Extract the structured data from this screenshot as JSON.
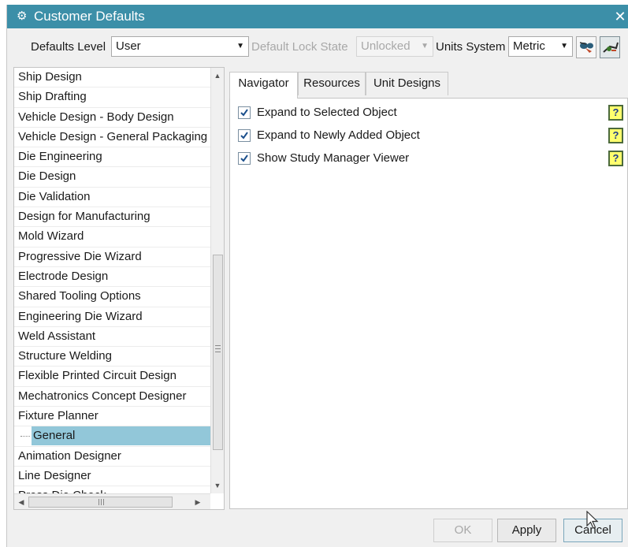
{
  "window": {
    "title": "Customer Defaults",
    "close_glyph": "✕",
    "title_icon": "gear-icon"
  },
  "toolbar": {
    "defaults_level_label": "Defaults Level",
    "defaults_level_value": "User",
    "lock_state_label": "Default Lock State",
    "lock_state_value": "Unlocked",
    "units_label": "Units System",
    "units_value": "Metric",
    "tool1_icon": "find-default-icon",
    "tool2_icon": "show-changed-icon"
  },
  "tree": {
    "items": [
      {
        "label": "Ship Design"
      },
      {
        "label": "Ship Drafting"
      },
      {
        "label": "Vehicle Design - Body Design"
      },
      {
        "label": "Vehicle Design - General Packaging"
      },
      {
        "label": "Die Engineering"
      },
      {
        "label": "Die Design"
      },
      {
        "label": "Die Validation"
      },
      {
        "label": "Design for Manufacturing"
      },
      {
        "label": "Mold Wizard"
      },
      {
        "label": "Progressive Die Wizard"
      },
      {
        "label": "Electrode Design"
      },
      {
        "label": "Shared Tooling Options"
      },
      {
        "label": "Engineering Die Wizard"
      },
      {
        "label": "Weld Assistant"
      },
      {
        "label": "Structure Welding"
      },
      {
        "label": "Flexible Printed Circuit Design"
      },
      {
        "label": "Mechatronics Concept Designer"
      },
      {
        "label": "Fixture Planner"
      },
      {
        "label": "General",
        "child": true,
        "selected": true
      },
      {
        "label": "Animation Designer"
      },
      {
        "label": "Line Designer"
      },
      {
        "label": "Press Die Check"
      }
    ],
    "hscroll_grip": "III"
  },
  "tabs": [
    {
      "label": "Navigator",
      "active": true
    },
    {
      "label": "Resources"
    },
    {
      "label": "Unit Designs"
    }
  ],
  "options": [
    {
      "label": "Expand to Selected Object",
      "checked": true
    },
    {
      "label": "Expand to Newly Added Object",
      "checked": true
    },
    {
      "label": "Show Study Manager Viewer",
      "checked": true
    }
  ],
  "help_glyph": "?",
  "buttons": {
    "ok": "OK",
    "apply": "Apply",
    "cancel": "Cancel"
  },
  "colors": {
    "titlebar": "#3c8fa8",
    "selection": "#92c7d9",
    "help_bg": "#ffff6e"
  }
}
